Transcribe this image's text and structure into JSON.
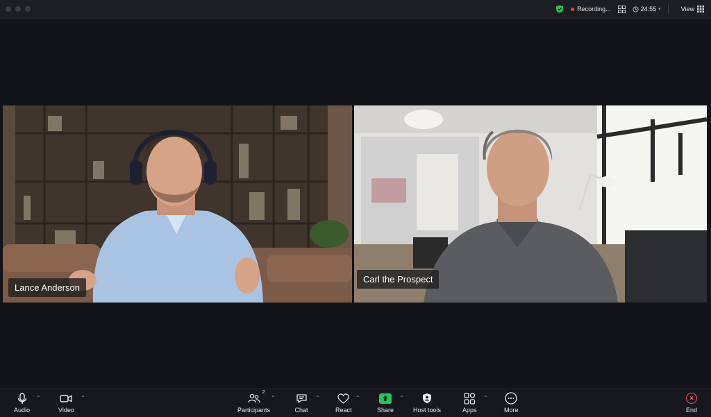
{
  "window": {
    "recording_label": "Recording...",
    "timer": "24:55",
    "view_label": "View"
  },
  "participants": [
    {
      "name": "Lance Anderson"
    },
    {
      "name": "Carl the Prospect"
    }
  ],
  "toolbar": {
    "audio": "Audio",
    "video": "Video",
    "participants": "Participants",
    "participants_count": "2",
    "chat": "Chat",
    "react": "React",
    "share": "Share",
    "host_tools": "Host tools",
    "apps": "Apps",
    "more": "More",
    "end": "End"
  },
  "colors": {
    "background": "#12141a",
    "share_accent": "#22c55e",
    "end_accent": "#ff4d5e",
    "shield_accent": "#22c55e",
    "recording_dot": "#ff3b30"
  }
}
